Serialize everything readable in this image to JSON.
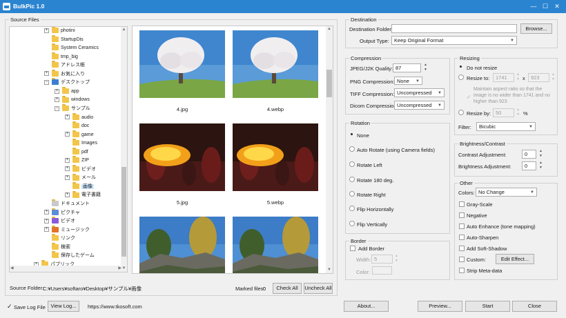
{
  "window": {
    "title": "BulkPic 1.0"
  },
  "source": {
    "group_label": "Source Files",
    "tree": [
      {
        "label": "photini",
        "depth": 3,
        "expander": "+",
        "icon": "folder-icon"
      },
      {
        "label": "StartupDis",
        "depth": 3,
        "expander": "",
        "icon": "folder-icon"
      },
      {
        "label": "System Ceramics",
        "depth": 3,
        "expander": "",
        "icon": "folder-icon"
      },
      {
        "label": "tmp_big",
        "depth": 3,
        "expander": "",
        "icon": "folder-icon"
      },
      {
        "label": "アドレス帳",
        "depth": 3,
        "expander": "",
        "icon": "folder-icon"
      },
      {
        "label": "お気に入り",
        "depth": 3,
        "expander": "+",
        "icon": "folder-icon"
      },
      {
        "label": "デスクトップ",
        "depth": 3,
        "expander": "−",
        "icon": "desktop-icon"
      },
      {
        "label": "app",
        "depth": 4,
        "expander": "+",
        "icon": "folder-icon"
      },
      {
        "label": "windows",
        "depth": 4,
        "expander": "+",
        "icon": "folder-icon"
      },
      {
        "label": "サンプル",
        "depth": 4,
        "expander": "−",
        "icon": "folder-icon"
      },
      {
        "label": "audio",
        "depth": 5,
        "expander": "+",
        "icon": "folder-icon"
      },
      {
        "label": "doc",
        "depth": 5,
        "expander": "",
        "icon": "folder-icon"
      },
      {
        "label": "game",
        "depth": 5,
        "expander": "+",
        "icon": "folder-icon"
      },
      {
        "label": "Images",
        "depth": 5,
        "expander": "",
        "icon": "folder-icon"
      },
      {
        "label": "pdf",
        "depth": 5,
        "expander": "",
        "icon": "folder-icon"
      },
      {
        "label": "ZIP",
        "depth": 5,
        "expander": "+",
        "icon": "folder-icon"
      },
      {
        "label": "ビデオ",
        "depth": 5,
        "expander": "+",
        "icon": "folder-icon"
      },
      {
        "label": "メール",
        "depth": 5,
        "expander": "+",
        "icon": "folder-icon"
      },
      {
        "label": "画像",
        "depth": 5,
        "expander": "",
        "icon": "folder-icon",
        "selected": true
      },
      {
        "label": "電子書籍",
        "depth": 5,
        "expander": "+",
        "icon": "folder-icon"
      },
      {
        "label": "ドキュメント",
        "depth": 3,
        "expander": "",
        "icon": "documents-icon"
      },
      {
        "label": "ピクチャ",
        "depth": 3,
        "expander": "+",
        "icon": "pictures-icon"
      },
      {
        "label": "ビデオ",
        "depth": 3,
        "expander": "+",
        "icon": "videos-icon"
      },
      {
        "label": "ミュージック",
        "depth": 3,
        "expander": "+",
        "icon": "music-icon"
      },
      {
        "label": "リンク",
        "depth": 3,
        "expander": "",
        "icon": "folder-icon"
      },
      {
        "label": "検索",
        "depth": 3,
        "expander": "",
        "icon": "folder-icon"
      },
      {
        "label": "保存したゲーム",
        "depth": 3,
        "expander": "",
        "icon": "folder-icon"
      },
      {
        "label": "パブリック",
        "depth": 2,
        "expander": "+",
        "icon": "folder-icon"
      }
    ],
    "thumbnails": [
      {
        "name": "4.jpg",
        "subject": "tree-photo"
      },
      {
        "name": "4.webp",
        "subject": "tree-photo"
      },
      {
        "name": "5.jpg",
        "subject": "fire-photo"
      },
      {
        "name": "5.webp",
        "subject": "fire-photo"
      },
      {
        "name": "",
        "subject": "landscape-photo"
      },
      {
        "name": "",
        "subject": "landscape-photo"
      }
    ],
    "folder_label": "Source Folder:",
    "folder_path": "C:¥Users¥softaro¥Desktop¥サンプル¥画像",
    "marked_label": "Marked files:",
    "marked_count": "0",
    "check_all": "Check All",
    "uncheck_all": "Uncheck All"
  },
  "destination": {
    "group_label": "Destination",
    "folder_label": "Destination Folder:",
    "folder_value": "",
    "browse": "Browse...",
    "output_type_label": "Output Type:",
    "output_type_value": "Keep Original Format"
  },
  "compression": {
    "group_label": "Compression",
    "jpeg_label": "JPEG/J2K Quality:",
    "jpeg_value": "87",
    "png_label": "PNG Compression:",
    "png_value": "None",
    "tiff_label": "TIFF Compression:",
    "tiff_value": "Uncompressed",
    "dicom_label": "Dicom Compression:",
    "dicom_value": "Uncompressed"
  },
  "resizing": {
    "group_label": "Resizing",
    "no_resize": "Do not resize",
    "resize_to": "Resize to:",
    "width": "1741",
    "x_sep": "x",
    "height": "923",
    "aspect_note": "Maintain aspect ratio so that the image is no wider than 1741 and no higher than 923",
    "resize_by": "Resize by:",
    "percent_value": "50",
    "percent_sign": "%",
    "filter_label": "Filter:",
    "filter_value": "Bicubic"
  },
  "rotation": {
    "group_label": "Rotation",
    "options": [
      "None",
      "Auto Rotate (using Camera fields)",
      "Rotate Left",
      "Rotate 180 deg.",
      "Rotate Right",
      "Flip Horizontally",
      "Flip Vertically"
    ],
    "selected": 0
  },
  "border": {
    "group_label": "Border",
    "add_border": "Add Border",
    "width_label": "Width:",
    "width_value": "5",
    "color_label": "Color:"
  },
  "brightness": {
    "group_label": "Brightness/Contrast",
    "contrast_label": "Contrast Adjustment:",
    "contrast_value": "0",
    "brightness_label": "Brightness Adjustment:",
    "brightness_value": "0"
  },
  "other": {
    "group_label": "Other",
    "colors_label": "Colors:",
    "colors_value": "No Change",
    "options": [
      "Gray-Scale",
      "Negative",
      "Auto Enhance (tone mapping)",
      "Auto-Sharpen",
      "Add Soft-Shadow",
      "Custom:",
      "Strip Meta-data"
    ],
    "edit_effect": "Edit Effect..."
  },
  "footer": {
    "save_log": "Save Log File",
    "view_log": "View Log...",
    "url": "https://www.tkosoft.com",
    "about": "About...",
    "preview": "Preview...",
    "start": "Start",
    "close": "Close"
  },
  "colors": {
    "titlebar": "#2b84d0",
    "selection": "#cce8ff"
  }
}
